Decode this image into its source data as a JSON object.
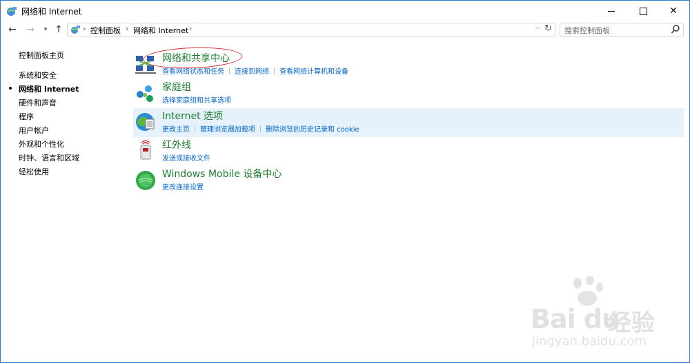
{
  "window": {
    "title": "网络和 Internet"
  },
  "address": {
    "crumbs": [
      "控制面板",
      "网络和 Internet"
    ],
    "search_placeholder": "搜索控制面板"
  },
  "sidebar": {
    "items": [
      {
        "label": "控制面板主页"
      },
      {
        "label": "系统和安全"
      },
      {
        "label": "网络和 Internet",
        "active": true
      },
      {
        "label": "硬件和声音"
      },
      {
        "label": "程序"
      },
      {
        "label": "用户帐户"
      },
      {
        "label": "外观和个性化"
      },
      {
        "label": "时钟、语言和区域"
      },
      {
        "label": "轻松使用"
      }
    ]
  },
  "categories": [
    {
      "title": "网络和共享中心",
      "links": [
        "查看网络状态和任务",
        "连接到网络",
        "查看网络计算机和设备"
      ]
    },
    {
      "title": "家庭组",
      "links": [
        "选择家庭组和共享选项"
      ]
    },
    {
      "title": "Internet 选项",
      "links": [
        "更改主页",
        "管理浏览器加载项",
        "删除浏览的历史记录和 cookie"
      ]
    },
    {
      "title": "红外线",
      "links": [
        "发送或接收文件"
      ]
    },
    {
      "title": "Windows Mobile 设备中心",
      "links": [
        "更改连接设置"
      ]
    }
  ],
  "watermark": {
    "brand": "Bai du",
    "brand_cn": "经验",
    "url": "jingyan.baidu.com"
  },
  "colors": {
    "category_title": "#1e7d2f",
    "link": "#0066cc",
    "hover_row": "#e5f1fb",
    "annotation": "#d9242c",
    "window_border": "#2b7bd6"
  }
}
